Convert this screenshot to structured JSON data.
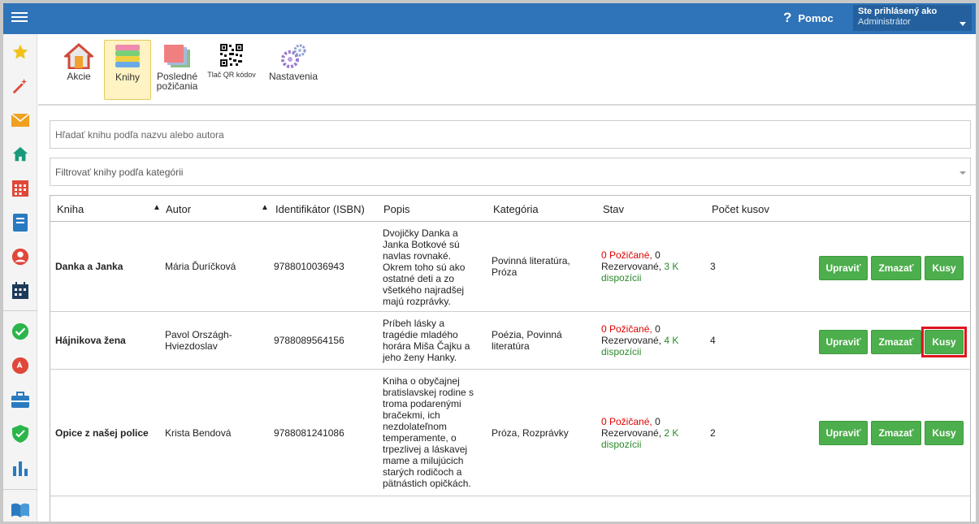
{
  "header": {
    "help_label": "Pomoc",
    "help_symbol": "?",
    "user_line1": "Ste prihlásený ako",
    "user_line2": "Administrátor"
  },
  "sidebar": {
    "icons": [
      "star-icon",
      "magic-wand-icon",
      "envelope-icon",
      "home-icon",
      "calendar-icon",
      "notebook-icon",
      "user-circle-icon",
      "schedule-icon",
      "check-circle-icon",
      "badge-icon",
      "briefcase-icon",
      "shield-check-icon",
      "bar-chart-icon",
      "open-book-icon"
    ]
  },
  "toolbar": {
    "items": [
      {
        "label": "Akcie",
        "icon": "house-door-icon"
      },
      {
        "label": "Knihy",
        "icon": "book-stack-icon"
      },
      {
        "label": "Posledné požičania",
        "icon": "cards-icon"
      },
      {
        "label": "Tlač QR kódov",
        "icon": "qr-code-icon"
      },
      {
        "label": "Nastavenia",
        "icon": "gears-icon"
      }
    ]
  },
  "search": {
    "placeholder": "Hľadať knihu podľa nazvu alebo autora"
  },
  "filter": {
    "placeholder": "Filtrovať knihy podľa kategórii"
  },
  "table": {
    "columns": [
      "Kniha",
      "Autor",
      "Identifikátor (ISBN)",
      "Popis",
      "Kategória",
      "Stav",
      "Počet kusov"
    ],
    "sort_symbol": "▲",
    "rows": [
      {
        "title": "Danka a Janka",
        "author": "Mária Ďuríčková",
        "isbn": "9788010036943",
        "description": "Dvojičky Danka a Janka Botkové sú navlas rovnaké. Okrem toho sú ako ostatné deti a zo všetkého najradšej majú rozprávky.",
        "category": "Povinná literatúra, Próza",
        "borrowed": "0 Požičané,",
        "reserved_num": "0",
        "reserved_label": "Rezervované,",
        "available": "3 K dispozícii",
        "count": "3"
      },
      {
        "title": "Hájnikova žena",
        "author": "Pavol Országh-Hviezdoslav",
        "isbn": "9788089564156",
        "description": "Príbeh lásky a tragédie mladého horára Miša Čajku a jeho ženy Hanky.",
        "category": "Poézia, Povinná literatúra",
        "borrowed": "0 Požičané,",
        "reserved_num": "0",
        "reserved_label": "Rezervované,",
        "available": "4 K dispozícii",
        "count": "4"
      },
      {
        "title": "Opice z našej police",
        "author": "Krista Bendová",
        "isbn": "9788081241086",
        "description": "Kniha o obyčajnej bratislavskej rodine s troma podarenými bračekmi, ich nezdolateľnom temperamente, o trpezlivej a láskavej mame a milujúcich starých rodičoch a pätnástich opičkách.",
        "category": "Próza, Rozprávky",
        "borrowed": "0 Požičané,",
        "reserved_num": "0",
        "reserved_label": "Rezervované,",
        "available": "2 K dispozícii",
        "count": "2"
      }
    ],
    "actions": {
      "edit": "Upraviť",
      "delete": "Zmazať",
      "copies": "Kusy"
    }
  },
  "colors": {
    "topbar": "#2f73b8",
    "button_green": "#4cae4c",
    "highlight_red": "#e0141e",
    "active_tool": "#fff3c4"
  }
}
